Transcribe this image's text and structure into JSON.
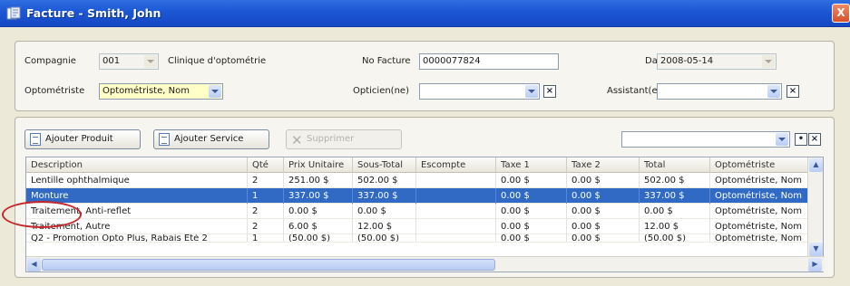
{
  "window": {
    "title": "Facture - Smith, John",
    "close_label": "X"
  },
  "header": {
    "compagnie_label": "Compagnie",
    "compagnie_value": "001",
    "clinic_name": "Clinique d'optométrie",
    "no_facture_label": "No Facture",
    "no_facture_value": "0000077824",
    "date_label": "Date",
    "date_value": "2008-05-14",
    "optometriste_label": "Optométriste",
    "optometriste_value": "Optométriste, Nom",
    "opticien_label": "Opticien(ne)",
    "opticien_value": "",
    "assistant_label": "Assistant(e)",
    "assistant_value": ""
  },
  "toolbar": {
    "add_product_label": "Ajouter Produit",
    "add_service_label": "Ajouter Service",
    "delete_label": "Supprimer",
    "filter_value": ""
  },
  "grid": {
    "columns": [
      "Description",
      "Qté",
      "Prix Unitaire",
      "Sous-Total",
      "Escompte",
      "Taxe 1",
      "Taxe 2",
      "Total",
      "Optométriste"
    ],
    "rows": [
      [
        "Lentille ophthalmique",
        "2",
        "251.00 $",
        "502.00 $",
        "",
        "0.00 $",
        "0.00 $",
        "502.00 $",
        "Optométriste, Nom"
      ],
      [
        "Monture",
        "1",
        "337.00 $",
        "337.00 $",
        "",
        "0.00 $",
        "0.00 $",
        "337.00 $",
        "Optométriste, Nom"
      ],
      [
        "Traitement, Anti-reflet",
        "2",
        "0.00 $",
        "0.00 $",
        "",
        "0.00 $",
        "0.00 $",
        "0.00 $",
        "Optométriste, Nom"
      ],
      [
        "Traitement, Autre",
        "2",
        "6.00 $",
        "12.00 $",
        "",
        "0.00 $",
        "0.00 $",
        "12.00 $",
        "Optométriste, Nom"
      ],
      [
        "Q2 - Promotion Opto Plus, Rabais Été 2",
        "1",
        "(50.00 $)",
        "(50.00 $)",
        "",
        "0.00 $",
        "0.00 $",
        "(50.00 $)",
        "Optométriste, Nom"
      ]
    ],
    "selected_row": 1
  },
  "icons": {
    "window": "invoice-window-icon",
    "dropdown": "chevron-down-icon",
    "clear": "close-icon",
    "add": "document-add-icon",
    "delete": "delete-x-icon"
  },
  "colors": {
    "titlebar": "#1c56d4",
    "selection": "#316ac5",
    "highlight_required_field": "#ffffc8",
    "annotation_circle": "#c4262b"
  }
}
